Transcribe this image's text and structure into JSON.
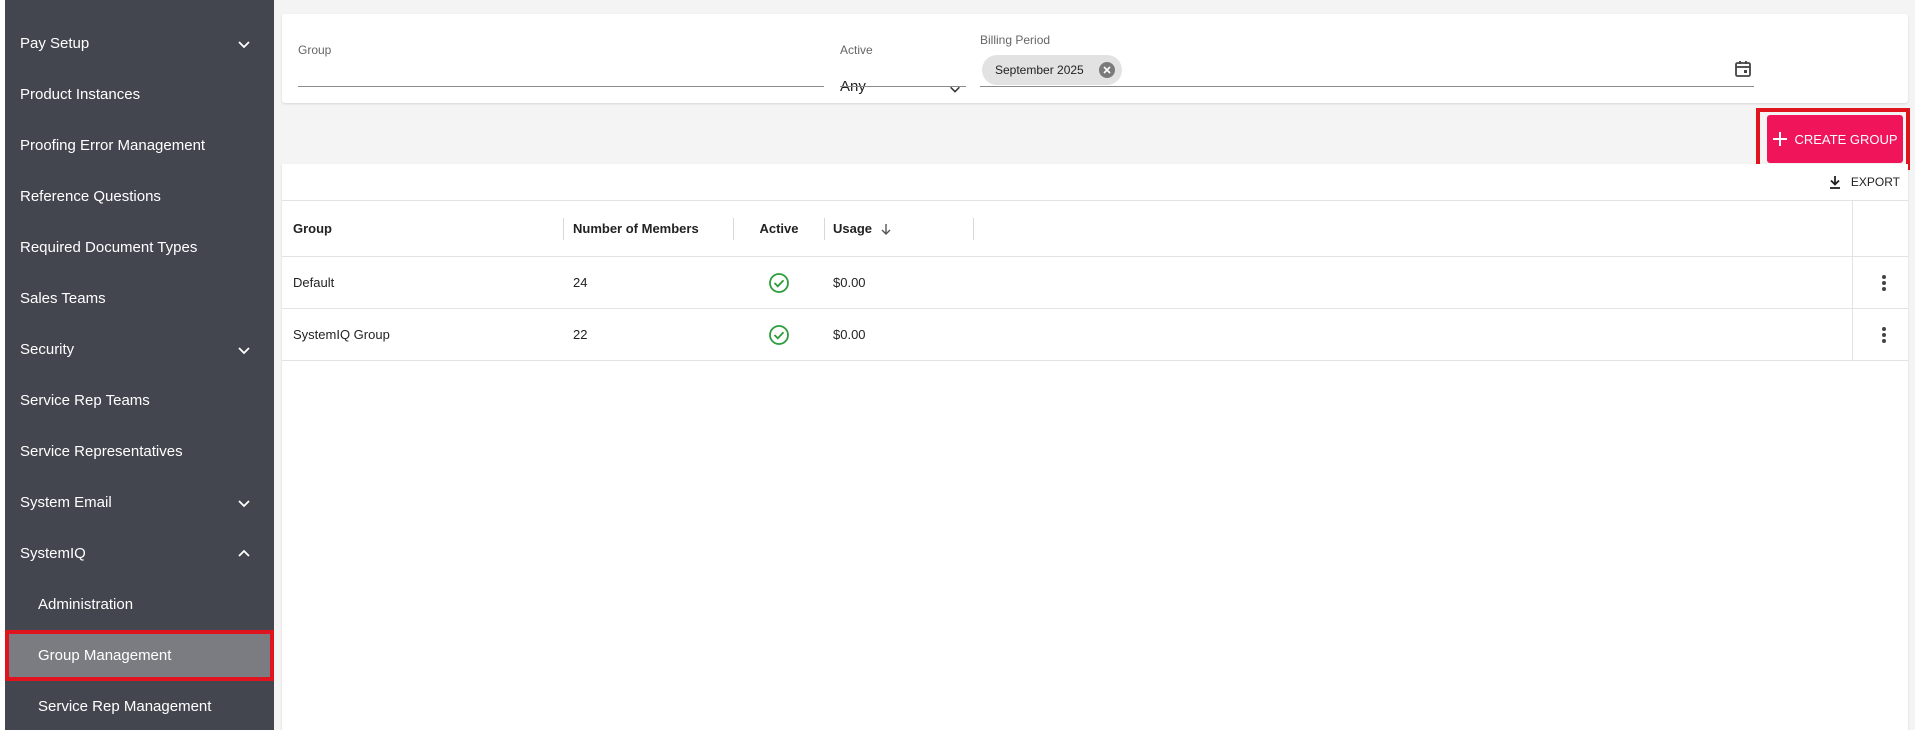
{
  "sidebar": {
    "items": [
      {
        "label": "Pay Setup",
        "chevron": "down"
      },
      {
        "label": "Product Instances"
      },
      {
        "label": "Proofing Error Management"
      },
      {
        "label": "Reference Questions"
      },
      {
        "label": "Required Document Types"
      },
      {
        "label": "Sales Teams"
      },
      {
        "label": "Security",
        "chevron": "down"
      },
      {
        "label": "Service Rep Teams"
      },
      {
        "label": "Service Representatives"
      },
      {
        "label": "System Email",
        "chevron": "down"
      },
      {
        "label": "SystemIQ",
        "chevron": "up"
      },
      {
        "label": "Administration"
      },
      {
        "label": "Group Management",
        "active": true
      },
      {
        "label": "Service Rep Management"
      }
    ]
  },
  "filters": {
    "group_label": "Group",
    "group_value": "",
    "active_label": "Active",
    "active_value": "Any",
    "billing_label": "Billing Period",
    "billing_chip": "September 2025"
  },
  "actions": {
    "create_label": "CREATE GROUP",
    "export_label": "EXPORT"
  },
  "table": {
    "headers": {
      "group": "Group",
      "members": "Number of Members",
      "active": "Active",
      "usage": "Usage"
    },
    "rows": [
      {
        "group": "Default",
        "members": "24",
        "active": true,
        "usage": "$0.00"
      },
      {
        "group": "SystemIQ Group",
        "members": "22",
        "active": true,
        "usage": "$0.00"
      }
    ]
  },
  "colors": {
    "sidebar_bg": "#43454f",
    "accent": "#f0145a",
    "highlight": "#e0141e",
    "success": "#2e9c3c"
  }
}
